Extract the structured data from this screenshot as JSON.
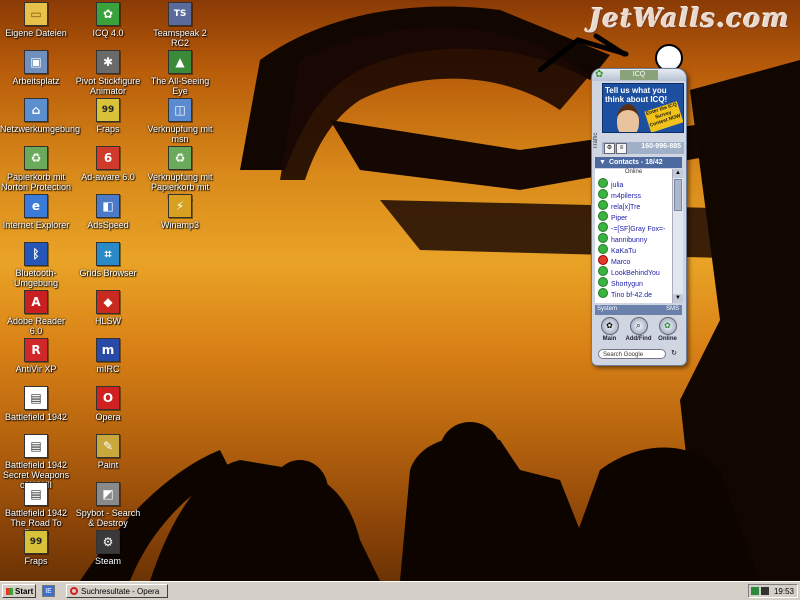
{
  "watermark": "JetWalls.com",
  "desktop_icons": [
    {
      "label": "Eigene Dateien",
      "icon": "folder-icon",
      "color": "#e8c14a",
      "glyph": "▭"
    },
    {
      "label": "Arbeitsplatz",
      "icon": "computer-icon",
      "color": "#6f8fbf",
      "glyph": "▣"
    },
    {
      "label": "Netzwerkumgebung",
      "icon": "network-icon",
      "color": "#5b8fd0",
      "glyph": "⌂"
    },
    {
      "label": "Papierkorb mit Norton Protection",
      "icon": "recycle-bin-icon",
      "color": "#6aaa5a",
      "glyph": "♻"
    },
    {
      "label": "Internet Explorer",
      "icon": "internet-explorer-icon",
      "color": "#3a7ad8",
      "glyph": "e"
    },
    {
      "label": "Bluetooth-Umgebung",
      "icon": "bluetooth-icon",
      "color": "#2557b8",
      "glyph": "ᛒ"
    },
    {
      "label": "Adobe Reader 6.0",
      "icon": "adobe-reader-icon",
      "color": "#c82020",
      "glyph": "A"
    },
    {
      "label": "AntiVir XP",
      "icon": "antivir-icon",
      "color": "#d02828",
      "glyph": "R"
    },
    {
      "label": "Battlefield 1942",
      "icon": "battlefield-icon",
      "color": "#ffffff",
      "glyph": "▤"
    },
    {
      "label": "Battlefield 1942 Secret Weapons of WWII",
      "icon": "battlefield-sw-icon",
      "color": "#ffffff",
      "glyph": "▤"
    },
    {
      "label": "Battlefield 1942 The Road To Rome",
      "icon": "battlefield-rtr-icon",
      "color": "#ffffff",
      "glyph": "▤"
    },
    {
      "label": "Fraps",
      "icon": "fraps-icon",
      "color": "#d8c23a",
      "glyph": "99"
    },
    {
      "label": "ICQ 4.0",
      "icon": "icq-icon",
      "color": "#3aa23a",
      "glyph": "✿"
    },
    {
      "label": "Pivot Stickfigure Animator",
      "icon": "pivot-icon",
      "color": "#6a6a6a",
      "glyph": "✱"
    },
    {
      "label": "Fraps",
      "icon": "fraps-icon",
      "color": "#d8c23a",
      "glyph": "99"
    },
    {
      "label": "Ad-aware 6.0",
      "icon": "ad-aware-icon",
      "color": "#d03a2a",
      "glyph": "6"
    },
    {
      "label": "AdsSpeed",
      "icon": "adsspeed-icon",
      "color": "#4a7ac8",
      "glyph": "◧"
    },
    {
      "label": "Grids Browser",
      "icon": "grids-browser-icon",
      "color": "#2a8ac8",
      "glyph": "⌗"
    },
    {
      "label": "HLSW",
      "icon": "hlsw-icon",
      "color": "#c82a20",
      "glyph": "◆"
    },
    {
      "label": "mIRC",
      "icon": "mirc-icon",
      "color": "#2a4aa8",
      "glyph": "m"
    },
    {
      "label": "Opera",
      "icon": "opera-icon",
      "color": "#d02020",
      "glyph": "O"
    },
    {
      "label": "Paint",
      "icon": "paint-icon",
      "color": "#c8a83a",
      "glyph": "✎"
    },
    {
      "label": "Spybot - Search & Destroy",
      "icon": "spybot-icon",
      "color": "#8a8a8a",
      "glyph": "◩"
    },
    {
      "label": "Steam",
      "icon": "steam-icon",
      "color": "#3a3a3a",
      "glyph": "⚙"
    },
    {
      "label": "Teamspeak 2 RC2",
      "icon": "teamspeak-icon",
      "color": "#5a6a9a",
      "glyph": "TS"
    },
    {
      "label": "The All-Seeing Eye",
      "icon": "all-seeing-eye-icon",
      "color": "#3a8a3a",
      "glyph": "▲"
    },
    {
      "label": "Verknüpfung mit msn",
      "icon": "msn-shortcut-icon",
      "color": "#5a8ad0",
      "glyph": "◫"
    },
    {
      "label": "Verknüpfung mit Papierkorb mit Nort...",
      "icon": "recycle-shortcut-icon",
      "color": "#6aaa5a",
      "glyph": "♻"
    },
    {
      "label": "Winamp3",
      "icon": "winamp-icon",
      "color": "#d8a020",
      "glyph": "⚡"
    }
  ],
  "icq": {
    "title": "ICQ",
    "ad_text": "Tell us what you think about ICQ!",
    "ad_badge": "Enter the ICQ Survey Contest NOW",
    "side_label": "Traffic",
    "uin": "160-996-885",
    "contacts_header": "Contacts - 18/42",
    "online_label": "Online",
    "contacts": [
      {
        "name": "julia",
        "status": "online"
      },
      {
        "name": "m4pilerss",
        "status": "online"
      },
      {
        "name": "rela[x]Tre",
        "status": "online"
      },
      {
        "name": "Piper",
        "status": "online"
      },
      {
        "name": "-=[SF]Gray Fox=-",
        "status": "online"
      },
      {
        "name": "hannibunny",
        "status": "online"
      },
      {
        "name": "KaKaTu",
        "status": "online"
      },
      {
        "name": "Marco",
        "status": "away"
      },
      {
        "name": "LookBehindYou",
        "status": "online"
      },
      {
        "name": "Shortygun",
        "status": "online"
      },
      {
        "name": "Tino bf-42.de",
        "status": "online"
      }
    ],
    "tab_system": "System",
    "tab_sms": "SMS",
    "btn_main": "Main",
    "btn_add_find": "Add/Find",
    "btn_online": "Online",
    "search_placeholder": "Search Google"
  },
  "taskbar": {
    "start_label": "Start",
    "quick_launch_ie": "IE",
    "task_opera": "Suchresultate - Opera",
    "clock": "19:53"
  }
}
